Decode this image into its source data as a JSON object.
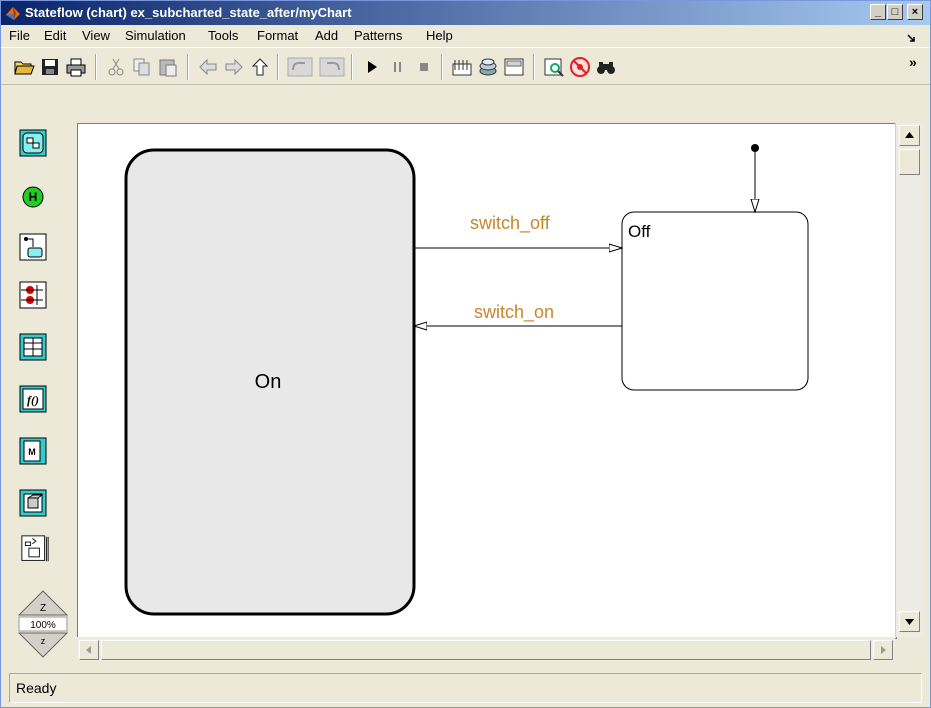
{
  "window": {
    "title": "Stateflow (chart) ex_subcharted_state_after/myChart",
    "min_label": "_",
    "max_label": "□",
    "close_label": "×"
  },
  "menu": {
    "items": [
      "File",
      "Edit",
      "View",
      "Simulation",
      "Tools",
      "Format",
      "Add",
      "Patterns",
      "Help"
    ]
  },
  "toolbar": {
    "overflow": "»"
  },
  "chart": {
    "state_on": "On",
    "state_off": "Off",
    "transition_off": "switch_off",
    "transition_on": "switch_on",
    "transition_color": "#c8862a"
  },
  "zoom": {
    "label": "100%",
    "in_label": "Z",
    "out_label": "z"
  },
  "status": {
    "text": "Ready"
  }
}
